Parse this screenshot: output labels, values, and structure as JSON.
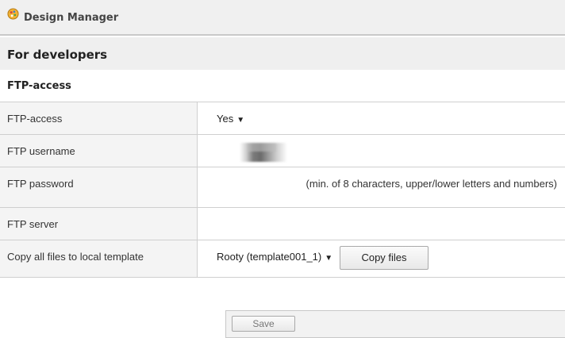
{
  "app": {
    "title": "Design Manager"
  },
  "section": {
    "title": "For developers"
  },
  "subsection": {
    "title": "FTP-access"
  },
  "rows": [
    {
      "label": "FTP-access",
      "value": "Yes"
    },
    {
      "label": "FTP username"
    },
    {
      "label": "FTP password",
      "hint": "(min. of 8 characters, upper/lower letters and numbers)"
    },
    {
      "label": "FTP server"
    },
    {
      "label": "Copy all files to local template",
      "value": "Rooty (template001_1)",
      "button": "Copy files"
    }
  ],
  "footer": {
    "save_label": "Save"
  },
  "icons": {
    "logo": "palette-logo-icon",
    "dropdown": "triangle-down-icon"
  }
}
